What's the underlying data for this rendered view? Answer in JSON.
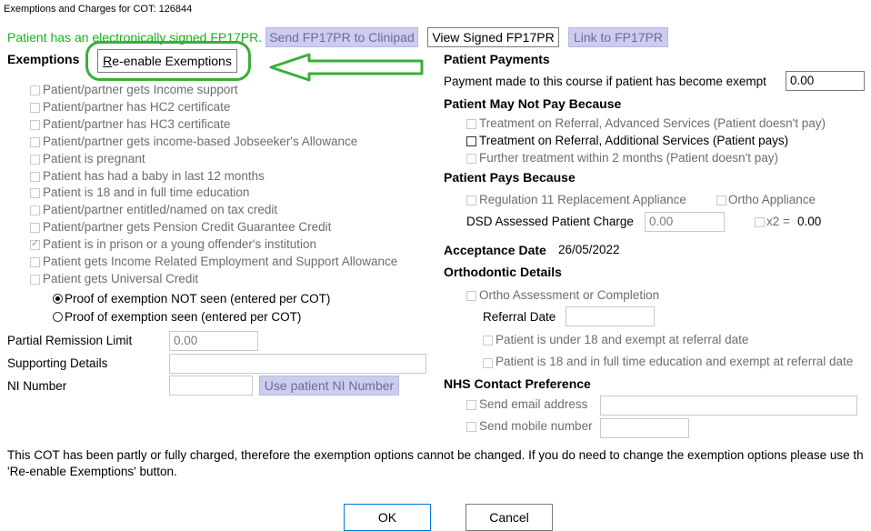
{
  "window_title": "Exemptions and Charges for COT: 126844",
  "fp17": {
    "status_text": "Patient has an electronically signed FP17PR.",
    "send_label": "Send FP17PR to Clinipad",
    "view_label": "View Signed FP17PR",
    "link_label": "Link to FP17PR"
  },
  "exemptions": {
    "heading": "Exemptions",
    "reenable_label": "Re-enable Exemptions",
    "items": [
      {
        "label": "Patient/partner gets Income support",
        "checked": false
      },
      {
        "label": "Patient/partner has HC2 certificate",
        "checked": false
      },
      {
        "label": "Patient/partner has HC3 certificate",
        "checked": false
      },
      {
        "label": "Patient/partner gets income-based Jobseeker's Allowance",
        "checked": false
      },
      {
        "label": "Patient is pregnant",
        "checked": false
      },
      {
        "label": "Patient has had a baby in last 12 months",
        "checked": false
      },
      {
        "label": "Patient is 18 and in full time education",
        "checked": false
      },
      {
        "label": "Patient/partner entitled/named on tax credit",
        "checked": false
      },
      {
        "label": "Patient/partner gets Pension Credit Guarantee Credit",
        "checked": false
      },
      {
        "label": "Patient is in prison or a young offender's institution",
        "checked": true
      },
      {
        "label": "Patient gets Income Related Employment and Support Allowance",
        "checked": false
      },
      {
        "label": "Patient gets Universal Credit",
        "checked": false
      }
    ],
    "proof_not_seen": "Proof of exemption NOT seen (entered per COT)",
    "proof_seen": "Proof of exemption seen (entered per COT)"
  },
  "fields": {
    "partial_remission_label": "Partial Remission Limit",
    "partial_remission_value": "0.00",
    "supporting_details_label": "Supporting Details",
    "supporting_details_value": "",
    "ni_number_label": "NI Number",
    "ni_number_value": "",
    "use_ni_label": "Use patient NI Number"
  },
  "payments": {
    "heading": "Patient Payments",
    "made_label": "Payment made to this course if patient has become exempt",
    "made_value": "0.00"
  },
  "may_not_pay": {
    "heading": "Patient May Not Pay Because",
    "items": [
      {
        "label": "Treatment on Referral, Advanced Services (Patient doesn't pay)",
        "enabled": false
      },
      {
        "label": "Treatment on Referral, Additional Services (Patient pays)",
        "enabled": true
      },
      {
        "label": "Further treatment within 2 months (Patient doesn't pay)",
        "enabled": false
      }
    ]
  },
  "pays_because": {
    "heading": "Patient Pays Because",
    "reg11_label": "Regulation 11 Replacement Appliance",
    "ortho_appliance_label": "Ortho Appliance",
    "dsd_label": "DSD Assessed Patient Charge",
    "dsd_value": "0.00",
    "x2_label": "x2 =",
    "x2_value": "0.00"
  },
  "acceptance": {
    "label": "Acceptance Date",
    "value": "26/05/2022"
  },
  "ortho": {
    "heading": "Orthodontic Details",
    "assessment_label": "Ortho Assessment or Completion",
    "referral_date_label": "Referral Date",
    "referral_date_value": "",
    "under18_label": "Patient is under 18 and exempt at referral date",
    "education_label": "Patient is 18 and in full time education and exempt at referral date"
  },
  "nhs_contact": {
    "heading": "NHS Contact Preference",
    "email_label": "Send email address",
    "email_value": "",
    "mobile_label": "Send mobile number",
    "mobile_value": ""
  },
  "notice": {
    "line1": "This COT has been partly or fully charged, therefore the exemption options cannot be changed. If you do need to change the exemption options please use th",
    "line2": "'Re-enable Exemptions' button."
  },
  "buttons": {
    "ok": "OK",
    "cancel": "Cancel"
  },
  "colors": {
    "annotation_green": "#3aae3a",
    "status_green": "#1ab21a",
    "disabled_button": "#ccccef"
  }
}
